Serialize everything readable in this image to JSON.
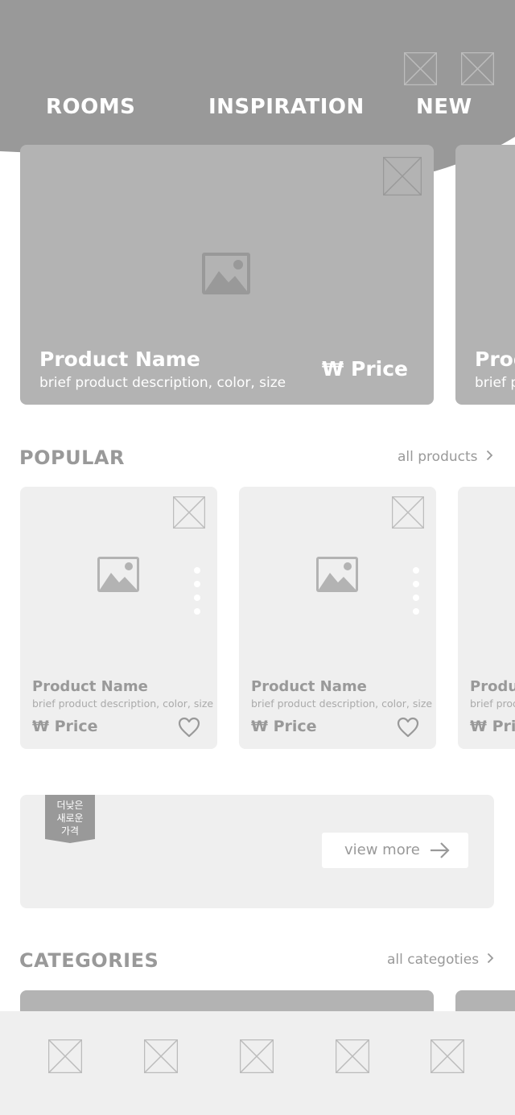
{
  "nav": {
    "items": [
      {
        "label": "ROOMS"
      },
      {
        "label": "INSPIRATION"
      },
      {
        "label": "NEW"
      }
    ],
    "header_color": "#999999"
  },
  "hero": {
    "cards": [
      {
        "name": "Product Name",
        "description": "brief product description, color, size",
        "price": "₩ Price"
      },
      {
        "name": "Product Name",
        "description": "brief product description, color, size"
      }
    ]
  },
  "popular": {
    "title": "POPULAR",
    "link_label": "all products",
    "cards": [
      {
        "name": "Product Name",
        "description": "brief product description, color, size",
        "price": "₩ Price"
      },
      {
        "name": "Product Name",
        "description": "brief product description, color, size",
        "price": "₩ Price"
      },
      {
        "name": "Product Name",
        "description": "brief product description, color, size",
        "price": "₩ Price"
      }
    ]
  },
  "promo": {
    "badge_line1": "더낮은",
    "badge_line2": "새로운",
    "badge_line3": "가격",
    "button_label": "view more"
  },
  "categories": {
    "title": "CATEGORIES",
    "link_label": "all categoties"
  },
  "colors": {
    "header": "#999999",
    "card_dark": "#b3b3b3",
    "card_light": "#efefef",
    "text_gray": "#999999"
  },
  "icons": {
    "placeholder": "x-placeholder-icon",
    "image": "image-icon",
    "heart": "heart-icon",
    "chevron": "chevron-right-icon",
    "arrow": "arrow-right-icon"
  }
}
